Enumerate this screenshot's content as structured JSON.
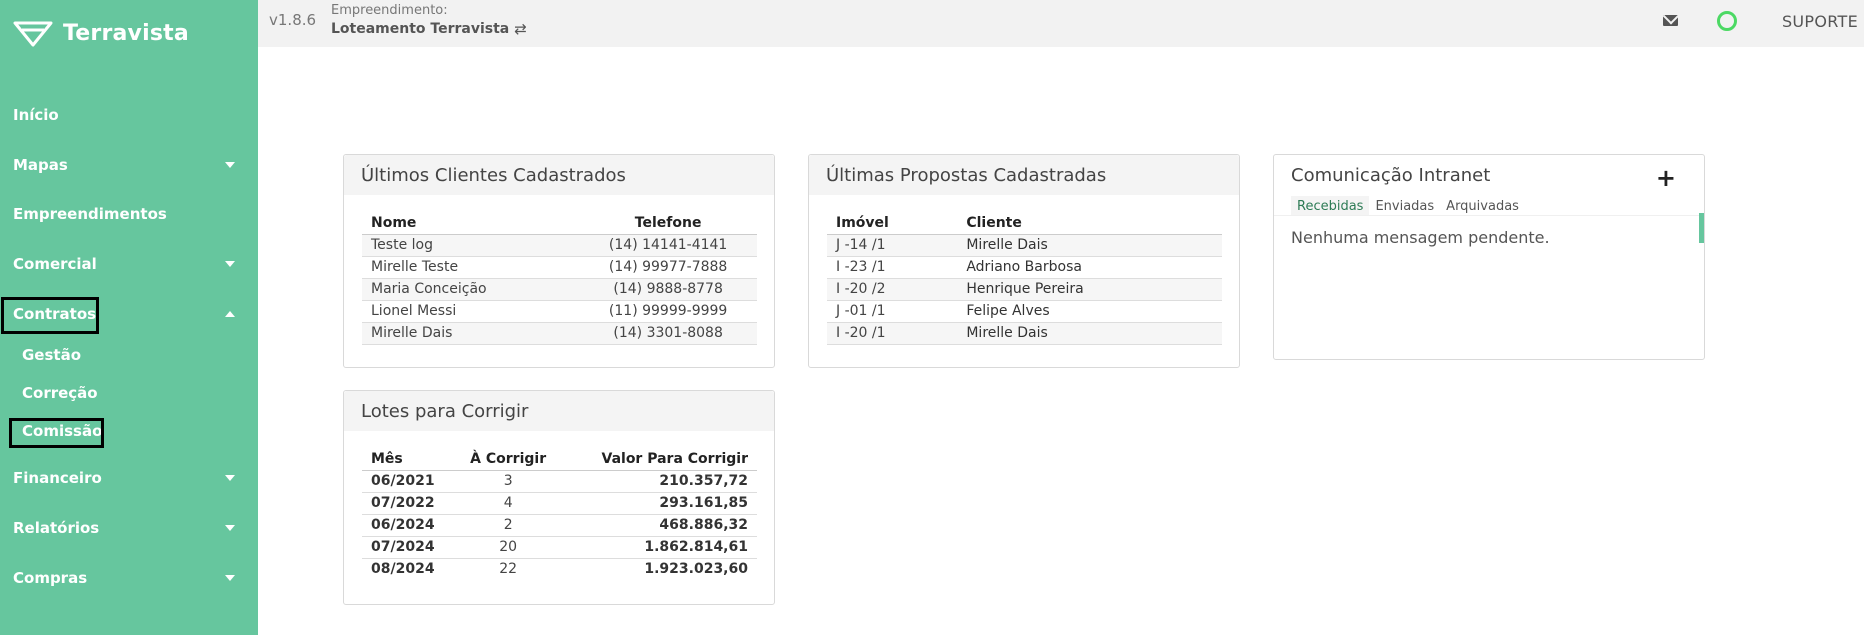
{
  "app": {
    "name": "Terravista",
    "version": "v1.8.6"
  },
  "header": {
    "empreendimento_label": "Empreendimento:",
    "empreendimento_name": "Loteamento Terravista",
    "swap_glyph": "⇄",
    "support_label": "SUPORTE",
    "status_color": "#4cd964"
  },
  "sidebar": {
    "background": "#66c69e",
    "items": [
      {
        "label": "Início"
      },
      {
        "label": "Mapas"
      },
      {
        "label": "Empreendimentos"
      },
      {
        "label": "Comercial"
      },
      {
        "label": "Contratos"
      },
      {
        "label": "Financeiro"
      },
      {
        "label": "Relatórios"
      },
      {
        "label": "Compras"
      }
    ],
    "contratos_sub": [
      {
        "label": "Gestão"
      },
      {
        "label": "Correção"
      },
      {
        "label": "Comissão"
      }
    ]
  },
  "clientes": {
    "title": "Últimos Clientes Cadastrados",
    "columns": [
      "Nome",
      "Telefone"
    ],
    "rows": [
      [
        "Teste log",
        "(14) 14141-4141"
      ],
      [
        "Mirelle Teste",
        "(14) 99977-7888"
      ],
      [
        "Maria Conceição",
        "(14) 9888-8778"
      ],
      [
        "Lionel Messi",
        "(11) 99999-9999"
      ],
      [
        "Mirelle Dais",
        "(14) 3301-8088"
      ]
    ]
  },
  "propostas": {
    "title": "Últimas Propostas Cadastradas",
    "columns": [
      "Imóvel",
      "Cliente"
    ],
    "rows": [
      [
        "J -14 /1",
        "Mirelle Dais"
      ],
      [
        "I -23 /1",
        "Adriano Barbosa"
      ],
      [
        "I -20 /2",
        "Henrique Pereira"
      ],
      [
        "J -01 /1",
        "Felipe Alves"
      ],
      [
        "I -20 /1",
        "Mirelle Dais"
      ]
    ]
  },
  "intranet": {
    "title": "Comunicação Intranet",
    "add_glyph": "+",
    "tabs": [
      "Recebidas",
      "Enviadas",
      "Arquivadas"
    ],
    "message": "Nenhuma mensagem pendente."
  },
  "lotes": {
    "title": "Lotes para Corrigir",
    "columns": [
      "Mês",
      "À Corrigir",
      "Valor Para Corrigir"
    ],
    "rows": [
      [
        "06/2021",
        "3",
        "210.357,72"
      ],
      [
        "07/2022",
        "4",
        "293.161,85"
      ],
      [
        "06/2024",
        "2",
        "468.886,32"
      ],
      [
        "07/2024",
        "20",
        "1.862.814,61"
      ],
      [
        "08/2024",
        "22",
        "1.923.023,60"
      ]
    ]
  }
}
